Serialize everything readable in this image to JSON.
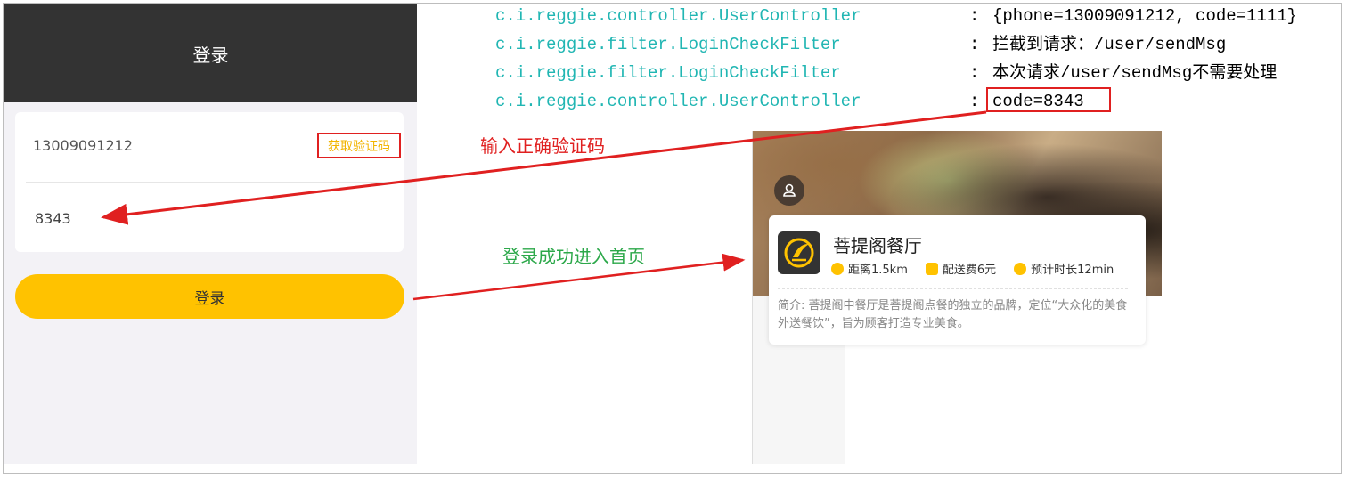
{
  "login": {
    "header_title": "登录",
    "phone_value": "13009091212",
    "get_code_label": "获取验证码",
    "code_value": "8343",
    "login_button": "登录"
  },
  "log": {
    "lines": [
      {
        "class": "c.i.reggie.controller.UserController",
        "sep": ":",
        "msg": "{phone=13009091212, code=1111}"
      },
      {
        "class": "c.i.reggie.filter.LoginCheckFilter",
        "sep": ":",
        "msg": "拦截到请求：/user/sendMsg"
      },
      {
        "class": "c.i.reggie.filter.LoginCheckFilter",
        "sep": ":",
        "msg": "本次请求/user/sendMsg不需要处理"
      },
      {
        "class": "c.i.reggie.controller.UserController",
        "sep": ":",
        "msg": "code=8343"
      }
    ]
  },
  "annotations": {
    "enter_code": "输入正确验证码",
    "login_success": "登录成功进入首页"
  },
  "home": {
    "shop_name": "菩提阁餐厅",
    "distance": "距离1.5km",
    "delivery_fee": "配送费6元",
    "eta": "预计时长12min",
    "description": "简介: 菩提阁中餐厅是菩提阁点餐的独立的品牌，定位“大众化的美食外送餐饮”，旨为顾客打造专业美食。"
  },
  "colors": {
    "header_bg": "#333333",
    "accent_yellow": "#ffc200",
    "annotation_red": "#e02020",
    "annotation_green": "#2ca84a",
    "log_class_teal": "#21b6b3"
  },
  "icons": {
    "avatar": "user-icon",
    "distance": "clock-icon",
    "delivery": "money-bag-icon",
    "eta": "navigation-arrow-icon"
  }
}
